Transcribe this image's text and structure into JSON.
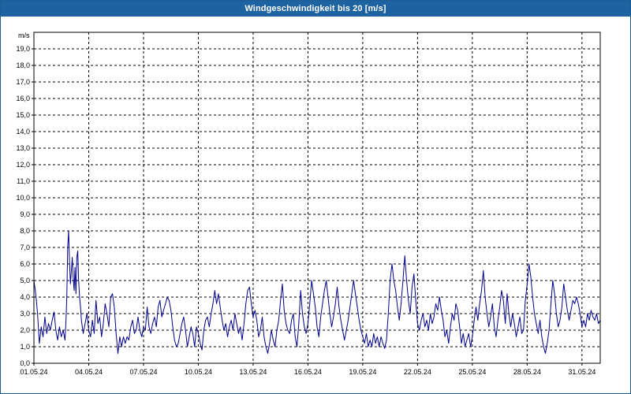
{
  "window": {
    "title": "Windgeschwindigkeit bis 20 [m/s]"
  },
  "colors": {
    "titlebar": "#1e63a1",
    "series": "#00008b",
    "grid": "#000000",
    "background": "#ffffff"
  },
  "chart_data": {
    "type": "line",
    "title": "Windgeschwindigkeit bis 20 [m/s]",
    "ylabel": "m/s",
    "xlabel": "",
    "ylim": [
      0,
      20
    ],
    "y_ticks": [
      "0,0",
      "1,0",
      "2,0",
      "3,0",
      "4,0",
      "5,0",
      "6,0",
      "7,0",
      "8,0",
      "9,0",
      "10,0",
      "11,0",
      "12,0",
      "13,0",
      "14,0",
      "15,0",
      "16,0",
      "17,0",
      "18,0",
      "19,0"
    ],
    "x_ticks": [
      "01.05.24",
      "04.05.24",
      "07.05.24",
      "10.05.24",
      "13.05.24",
      "16.05.24",
      "19.05.24",
      "22.05.24",
      "25.05.24",
      "28.05.24",
      "31.05.24"
    ],
    "x_range": [
      "01.05.24",
      "01.06.24"
    ],
    "grid": true,
    "legend": "none",
    "series": [
      {
        "x_unit": "days since 01.05.24",
        "points": [
          [
            0.0,
            5.0
          ],
          [
            0.1,
            4.2
          ],
          [
            0.2,
            3.0
          ],
          [
            0.3,
            1.2
          ],
          [
            0.4,
            2.2
          ],
          [
            0.5,
            1.6
          ],
          [
            0.6,
            2.8
          ],
          [
            0.7,
            1.8
          ],
          [
            0.8,
            2.4
          ],
          [
            0.9,
            2.0
          ],
          [
            1.0,
            2.6
          ],
          [
            1.1,
            3.1
          ],
          [
            1.2,
            2.0
          ],
          [
            1.3,
            1.4
          ],
          [
            1.4,
            2.2
          ],
          [
            1.5,
            1.6
          ],
          [
            1.6,
            2.0
          ],
          [
            1.7,
            1.4
          ],
          [
            1.75,
            2.4
          ],
          [
            1.8,
            4.0
          ],
          [
            1.85,
            7.0
          ],
          [
            1.9,
            8.0
          ],
          [
            1.95,
            6.0
          ],
          [
            2.0,
            4.8
          ],
          [
            2.05,
            5.6
          ],
          [
            2.1,
            6.4
          ],
          [
            2.15,
            5.2
          ],
          [
            2.2,
            4.4
          ],
          [
            2.25,
            5.8
          ],
          [
            2.3,
            4.2
          ],
          [
            2.35,
            6.4
          ],
          [
            2.4,
            6.8
          ],
          [
            2.45,
            5.0
          ],
          [
            2.5,
            4.0
          ],
          [
            2.55,
            3.4
          ],
          [
            2.6,
            2.6
          ],
          [
            2.7,
            1.8
          ],
          [
            2.8,
            2.4
          ],
          [
            2.9,
            3.0
          ],
          [
            3.0,
            2.0
          ],
          [
            3.1,
            1.6
          ],
          [
            3.2,
            2.6
          ],
          [
            3.3,
            1.8
          ],
          [
            3.4,
            3.8
          ],
          [
            3.5,
            2.4
          ],
          [
            3.6,
            2.8
          ],
          [
            3.7,
            1.6
          ],
          [
            3.8,
            2.4
          ],
          [
            3.9,
            3.6
          ],
          [
            4.0,
            3.0
          ],
          [
            4.1,
            2.2
          ],
          [
            4.2,
            4.0
          ],
          [
            4.3,
            4.2
          ],
          [
            4.4,
            3.4
          ],
          [
            4.5,
            1.8
          ],
          [
            4.6,
            0.6
          ],
          [
            4.7,
            1.6
          ],
          [
            4.8,
            1.0
          ],
          [
            4.9,
            1.6
          ],
          [
            5.0,
            1.2
          ],
          [
            5.1,
            1.6
          ],
          [
            5.2,
            1.4
          ],
          [
            5.3,
            2.2
          ],
          [
            5.4,
            2.6
          ],
          [
            5.5,
            1.8
          ],
          [
            5.6,
            2.0
          ],
          [
            5.7,
            2.8
          ],
          [
            5.8,
            2.0
          ],
          [
            5.9,
            1.6
          ],
          [
            6.0,
            2.2
          ],
          [
            6.1,
            2.0
          ],
          [
            6.2,
            3.4
          ],
          [
            6.3,
            2.2
          ],
          [
            6.4,
            1.8
          ],
          [
            6.5,
            2.4
          ],
          [
            6.6,
            2.8
          ],
          [
            6.7,
            2.2
          ],
          [
            6.8,
            3.4
          ],
          [
            6.9,
            3.8
          ],
          [
            7.0,
            2.8
          ],
          [
            7.1,
            3.2
          ],
          [
            7.2,
            3.6
          ],
          [
            7.3,
            4.0
          ],
          [
            7.4,
            3.8
          ],
          [
            7.5,
            3.2
          ],
          [
            7.6,
            2.2
          ],
          [
            7.7,
            1.4
          ],
          [
            7.8,
            1.0
          ],
          [
            7.9,
            1.2
          ],
          [
            8.0,
            1.8
          ],
          [
            8.1,
            2.4
          ],
          [
            8.2,
            2.8
          ],
          [
            8.3,
            2.0
          ],
          [
            8.4,
            1.0
          ],
          [
            8.5,
            1.6
          ],
          [
            8.6,
            2.2
          ],
          [
            8.7,
            1.8
          ],
          [
            8.8,
            1.0
          ],
          [
            8.9,
            2.2
          ],
          [
            9.0,
            1.8
          ],
          [
            9.1,
            1.2
          ],
          [
            9.2,
            0.8
          ],
          [
            9.3,
            2.0
          ],
          [
            9.4,
            2.6
          ],
          [
            9.5,
            2.8
          ],
          [
            9.6,
            2.2
          ],
          [
            9.7,
            3.0
          ],
          [
            9.8,
            3.6
          ],
          [
            9.9,
            4.4
          ],
          [
            10.0,
            3.6
          ],
          [
            10.1,
            4.2
          ],
          [
            10.2,
            3.4
          ],
          [
            10.3,
            2.6
          ],
          [
            10.4,
            2.0
          ],
          [
            10.5,
            2.4
          ],
          [
            10.6,
            1.6
          ],
          [
            10.7,
            2.2
          ],
          [
            10.8,
            2.6
          ],
          [
            10.9,
            2.0
          ],
          [
            11.0,
            3.0
          ],
          [
            11.1,
            2.4
          ],
          [
            11.2,
            1.8
          ],
          [
            11.3,
            2.2
          ],
          [
            11.4,
            1.4
          ],
          [
            11.5,
            2.4
          ],
          [
            11.6,
            3.6
          ],
          [
            11.7,
            4.4
          ],
          [
            11.8,
            4.6
          ],
          [
            11.9,
            3.6
          ],
          [
            12.0,
            2.8
          ],
          [
            12.1,
            3.2
          ],
          [
            12.2,
            2.6
          ],
          [
            12.3,
            1.6
          ],
          [
            12.4,
            2.0
          ],
          [
            12.5,
            2.8
          ],
          [
            12.6,
            1.6
          ],
          [
            12.7,
            1.0
          ],
          [
            12.8,
            0.6
          ],
          [
            12.9,
            1.2
          ],
          [
            13.0,
            2.0
          ],
          [
            13.1,
            1.4
          ],
          [
            13.2,
            1.0
          ],
          [
            13.3,
            2.0
          ],
          [
            13.4,
            2.6
          ],
          [
            13.5,
            3.8
          ],
          [
            13.6,
            4.8
          ],
          [
            13.7,
            3.2
          ],
          [
            13.8,
            2.4
          ],
          [
            13.9,
            2.0
          ],
          [
            14.0,
            1.8
          ],
          [
            14.1,
            2.6
          ],
          [
            14.2,
            3.0
          ],
          [
            14.3,
            1.6
          ],
          [
            14.4,
            1.0
          ],
          [
            14.5,
            2.4
          ],
          [
            14.6,
            4.4
          ],
          [
            14.7,
            3.0
          ],
          [
            14.8,
            2.2
          ],
          [
            14.9,
            1.8
          ],
          [
            15.0,
            2.4
          ],
          [
            15.1,
            3.6
          ],
          [
            15.2,
            5.0
          ],
          [
            15.3,
            4.2
          ],
          [
            15.4,
            3.4
          ],
          [
            15.5,
            2.2
          ],
          [
            15.6,
            1.6
          ],
          [
            15.7,
            2.8
          ],
          [
            15.8,
            3.6
          ],
          [
            15.9,
            4.4
          ],
          [
            16.0,
            5.0
          ],
          [
            16.1,
            4.0
          ],
          [
            16.2,
            3.0
          ],
          [
            16.3,
            2.2
          ],
          [
            16.4,
            2.8
          ],
          [
            16.5,
            3.6
          ],
          [
            16.6,
            4.6
          ],
          [
            16.7,
            3.4
          ],
          [
            16.8,
            2.6
          ],
          [
            16.9,
            2.0
          ],
          [
            17.0,
            1.4
          ],
          [
            17.1,
            2.0
          ],
          [
            17.2,
            2.6
          ],
          [
            17.3,
            3.4
          ],
          [
            17.4,
            4.2
          ],
          [
            17.5,
            5.0
          ],
          [
            17.6,
            4.2
          ],
          [
            17.7,
            3.4
          ],
          [
            17.8,
            2.6
          ],
          [
            17.9,
            2.0
          ],
          [
            18.0,
            1.6
          ],
          [
            18.1,
            1.2
          ],
          [
            18.2,
            1.8
          ],
          [
            18.3,
            1.0
          ],
          [
            18.4,
            1.4
          ],
          [
            18.5,
            1.0
          ],
          [
            18.6,
            1.8
          ],
          [
            18.7,
            1.2
          ],
          [
            18.8,
            1.6
          ],
          [
            18.9,
            1.0
          ],
          [
            19.0,
            1.6
          ],
          [
            19.1,
            1.2
          ],
          [
            19.2,
            0.9
          ],
          [
            19.3,
            1.4
          ],
          [
            19.4,
            3.0
          ],
          [
            19.5,
            5.0
          ],
          [
            19.6,
            6.0
          ],
          [
            19.7,
            5.0
          ],
          [
            19.8,
            4.4
          ],
          [
            19.9,
            3.4
          ],
          [
            20.0,
            2.6
          ],
          [
            20.1,
            3.6
          ],
          [
            20.2,
            5.0
          ],
          [
            20.3,
            6.5
          ],
          [
            20.4,
            5.0
          ],
          [
            20.5,
            3.8
          ],
          [
            20.6,
            3.0
          ],
          [
            20.7,
            4.6
          ],
          [
            20.8,
            5.4
          ],
          [
            20.9,
            3.8
          ],
          [
            21.0,
            2.4
          ],
          [
            21.1,
            2.0
          ],
          [
            21.2,
            2.6
          ],
          [
            21.3,
            3.0
          ],
          [
            21.4,
            2.2
          ],
          [
            21.5,
            2.6
          ],
          [
            21.6,
            2.0
          ],
          [
            21.7,
            3.0
          ],
          [
            21.8,
            2.4
          ],
          [
            21.9,
            2.8
          ],
          [
            22.0,
            3.6
          ],
          [
            22.1,
            3.2
          ],
          [
            22.2,
            4.0
          ],
          [
            22.3,
            3.2
          ],
          [
            22.4,
            2.6
          ],
          [
            22.5,
            1.6
          ],
          [
            22.6,
            2.0
          ],
          [
            22.7,
            1.2
          ],
          [
            22.8,
            2.2
          ],
          [
            22.9,
            3.0
          ],
          [
            23.0,
            2.6
          ],
          [
            23.1,
            3.6
          ],
          [
            23.2,
            3.2
          ],
          [
            23.3,
            2.2
          ],
          [
            23.4,
            1.2
          ],
          [
            23.5,
            1.8
          ],
          [
            23.6,
            1.0
          ],
          [
            23.7,
            1.4
          ],
          [
            23.8,
            1.8
          ],
          [
            23.9,
            1.0
          ],
          [
            24.0,
            1.6
          ],
          [
            24.1,
            2.6
          ],
          [
            24.2,
            3.4
          ],
          [
            24.3,
            2.6
          ],
          [
            24.4,
            3.6
          ],
          [
            24.5,
            4.4
          ],
          [
            24.6,
            5.6
          ],
          [
            24.7,
            4.0
          ],
          [
            24.8,
            3.0
          ],
          [
            24.9,
            2.2
          ],
          [
            25.0,
            2.8
          ],
          [
            25.1,
            3.6
          ],
          [
            25.2,
            2.2
          ],
          [
            25.3,
            1.6
          ],
          [
            25.4,
            2.6
          ],
          [
            25.5,
            3.4
          ],
          [
            25.6,
            4.4
          ],
          [
            25.7,
            3.8
          ],
          [
            25.8,
            2.4
          ],
          [
            25.9,
            4.2
          ],
          [
            26.0,
            3.0
          ],
          [
            26.1,
            2.2
          ],
          [
            26.2,
            3.0
          ],
          [
            26.3,
            2.4
          ],
          [
            26.4,
            1.6
          ],
          [
            26.5,
            2.2
          ],
          [
            26.6,
            2.8
          ],
          [
            26.7,
            1.8
          ],
          [
            26.8,
            2.0
          ],
          [
            26.9,
            3.8
          ],
          [
            27.0,
            4.8
          ],
          [
            27.1,
            6.0
          ],
          [
            27.2,
            5.2
          ],
          [
            27.3,
            4.0
          ],
          [
            27.4,
            3.0
          ],
          [
            27.5,
            2.4
          ],
          [
            27.6,
            1.8
          ],
          [
            27.7,
            2.6
          ],
          [
            27.8,
            1.6
          ],
          [
            27.9,
            1.0
          ],
          [
            28.0,
            0.6
          ],
          [
            28.1,
            1.2
          ],
          [
            28.2,
            2.0
          ],
          [
            28.3,
            3.6
          ],
          [
            28.4,
            5.0
          ],
          [
            28.5,
            4.2
          ],
          [
            28.6,
            3.0
          ],
          [
            28.7,
            2.2
          ],
          [
            28.8,
            2.6
          ],
          [
            28.9,
            3.4
          ],
          [
            29.0,
            4.8
          ],
          [
            29.1,
            4.0
          ],
          [
            29.2,
            3.2
          ],
          [
            29.3,
            2.6
          ],
          [
            29.4,
            3.2
          ],
          [
            29.5,
            3.8
          ],
          [
            29.6,
            3.6
          ],
          [
            29.7,
            4.0
          ],
          [
            29.8,
            3.6
          ],
          [
            29.9,
            3.0
          ],
          [
            30.0,
            2.2
          ],
          [
            30.1,
            2.6
          ],
          [
            30.2,
            2.2
          ],
          [
            30.3,
            3.0
          ],
          [
            30.4,
            2.6
          ],
          [
            30.5,
            3.2
          ],
          [
            30.6,
            2.8
          ],
          [
            30.7,
            2.6
          ],
          [
            30.8,
            3.0
          ],
          [
            30.9,
            2.4
          ],
          [
            31.0,
            2.6
          ]
        ]
      }
    ]
  }
}
